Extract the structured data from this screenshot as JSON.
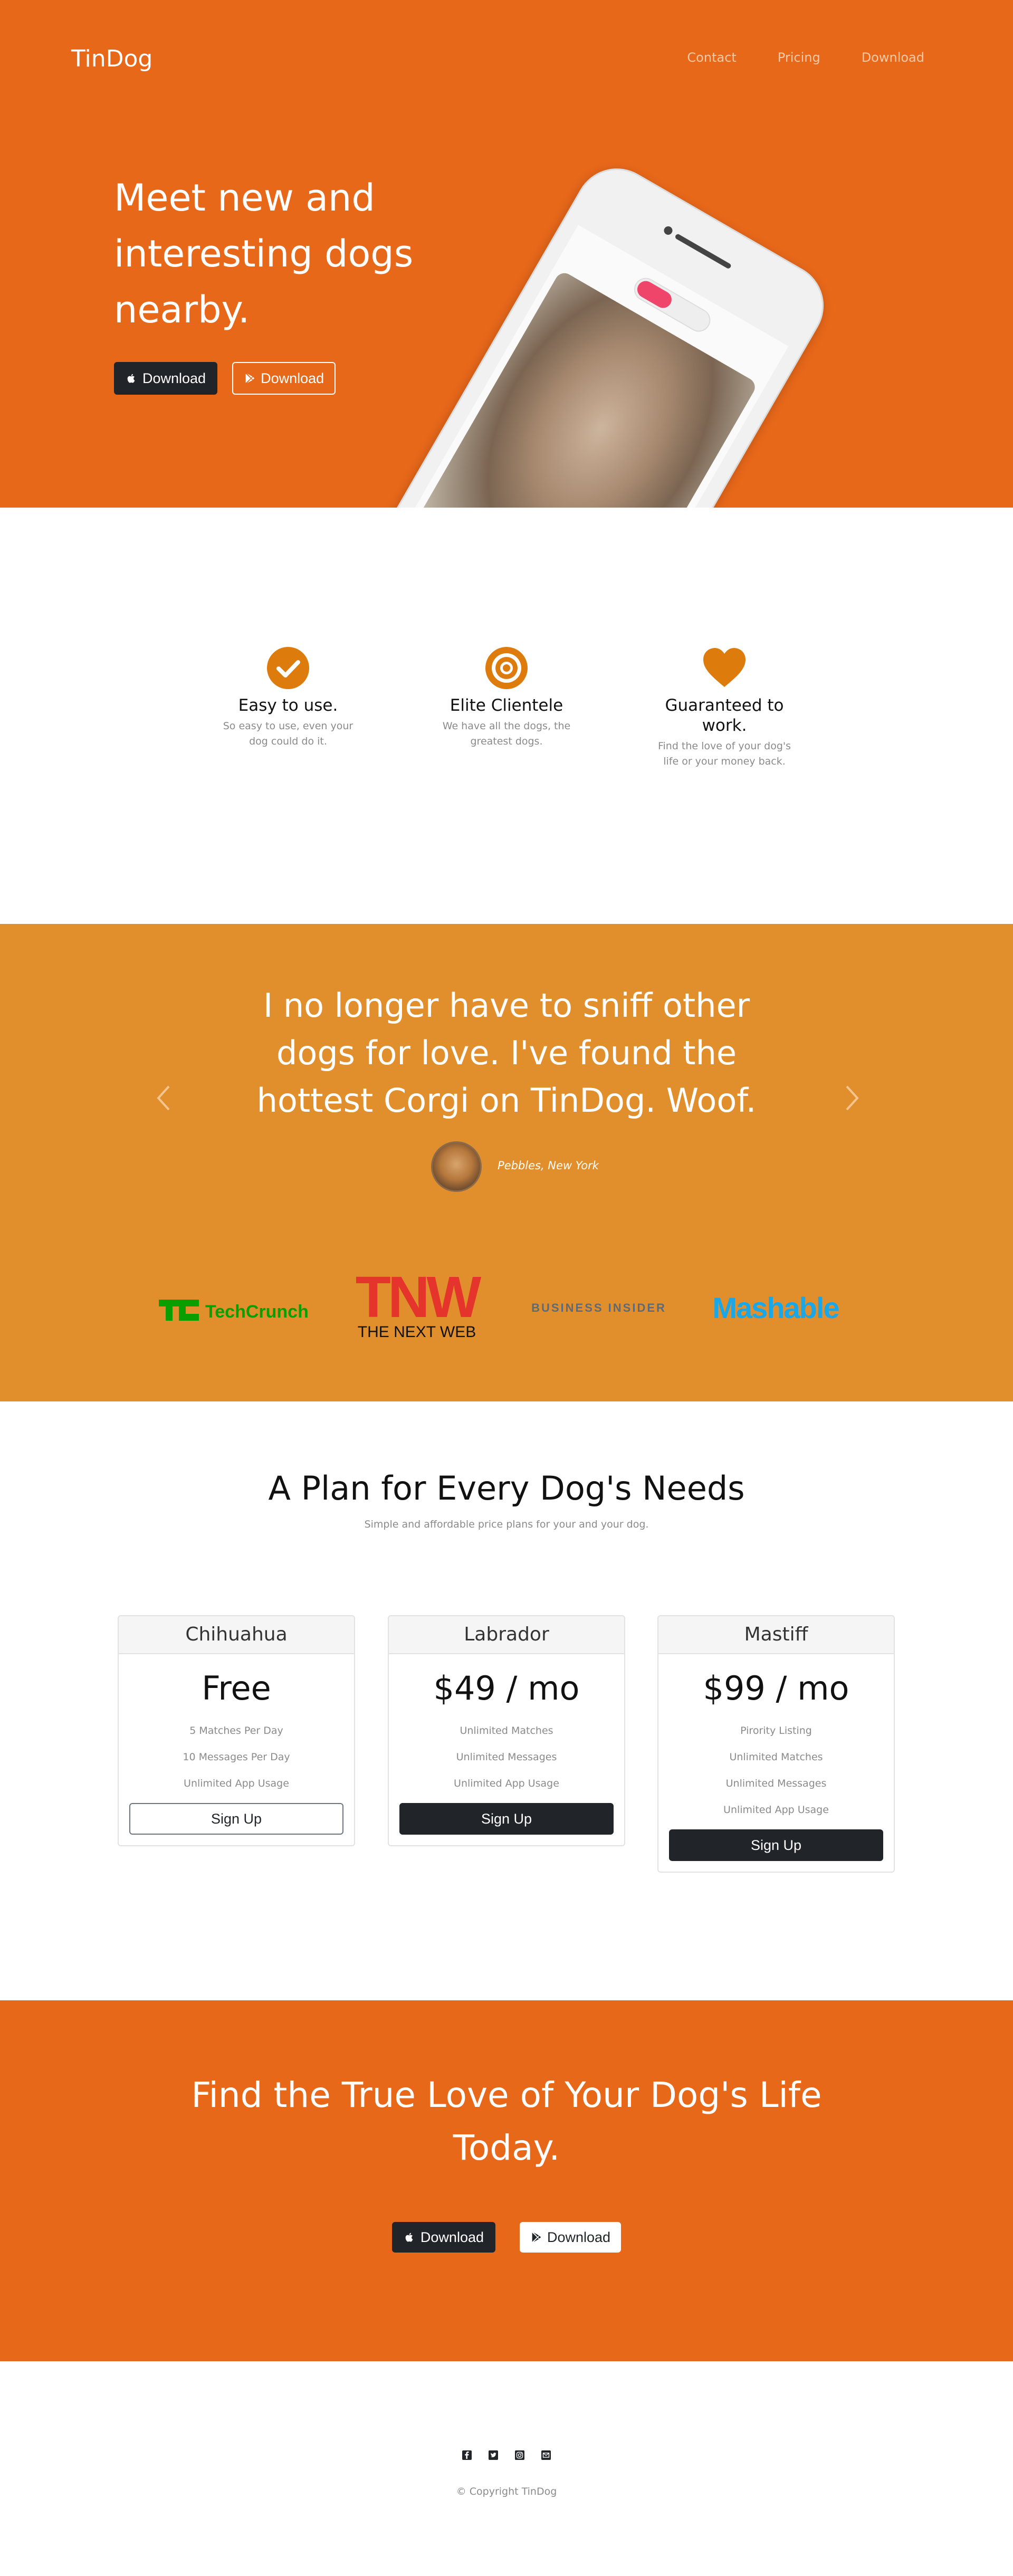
{
  "nav": {
    "brand": "TinDog",
    "links": [
      "Contact",
      "Pricing",
      "Download"
    ]
  },
  "hero": {
    "title": "Meet new and interesting dogs nearby.",
    "buttons": [
      {
        "label": "Download",
        "icon": "apple-icon"
      },
      {
        "label": "Download",
        "icon": "google-play-icon"
      }
    ]
  },
  "features": [
    {
      "icon": "check-circle-icon",
      "title": "Easy to use.",
      "text": "So easy to use, even your dog could do it."
    },
    {
      "icon": "bullseye-icon",
      "title": "Elite Clientele",
      "text": "We have all the dogs, the greatest dogs."
    },
    {
      "icon": "heart-icon",
      "title": "Guaranteed to work.",
      "text": "Find the love of your dog's life or your money back."
    }
  ],
  "testimonial": {
    "quote": "I no longer have to sniff other dogs for love. I've found the hottest Corgi on TinDog. Woof.",
    "reviewer": "Pebbles, New York"
  },
  "press": [
    {
      "name": "techcrunch-logo",
      "mark": "TC",
      "word": "TechCrunch",
      "color": "#0a9e01"
    },
    {
      "name": "tnw-logo",
      "mark": "TNW",
      "word": "THE NEXT WEB",
      "color": "#e5342b"
    },
    {
      "name": "business-insider-logo",
      "word": "BUSINESS INSIDER",
      "color": "#5d6a78"
    },
    {
      "name": "mashable-logo",
      "word": "Mashable",
      "color": "#1aa7e8"
    }
  ],
  "pricing": {
    "title": "A Plan for Every Dog's Needs",
    "subtitle": "Simple and affordable price plans for your and your dog.",
    "plans": [
      {
        "name": "Chihuahua",
        "price": "Free",
        "features": [
          "5 Matches Per Day",
          "10 Messages Per Day",
          "Unlimited App Usage"
        ],
        "cta": "Sign Up"
      },
      {
        "name": "Labrador",
        "price": "$49 / mo",
        "features": [
          "Unlimited Matches",
          "Unlimited Messages",
          "Unlimited App Usage"
        ],
        "cta": "Sign Up"
      },
      {
        "name": "Mastiff",
        "price": "$99 / mo",
        "features": [
          "Pirority Listing",
          "Unlimited Matches",
          "Unlimited Messages",
          "Unlimited App Usage"
        ],
        "cta": "Sign Up"
      }
    ]
  },
  "cta": {
    "title": "Find the True Love of Your Dog's Life Today.",
    "buttons": [
      {
        "label": "Download",
        "icon": "apple-icon"
      },
      {
        "label": "Download",
        "icon": "google-play-icon"
      }
    ]
  },
  "footer": {
    "socials": [
      "facebook-icon",
      "twitter-icon",
      "instagram-icon",
      "email-icon"
    ],
    "copyright": "© Copyright TinDog"
  },
  "colors": {
    "hero": "#e8681a",
    "accent": "#e18f2c",
    "feature_icon": "#dd7b0d",
    "dark": "#212529"
  }
}
